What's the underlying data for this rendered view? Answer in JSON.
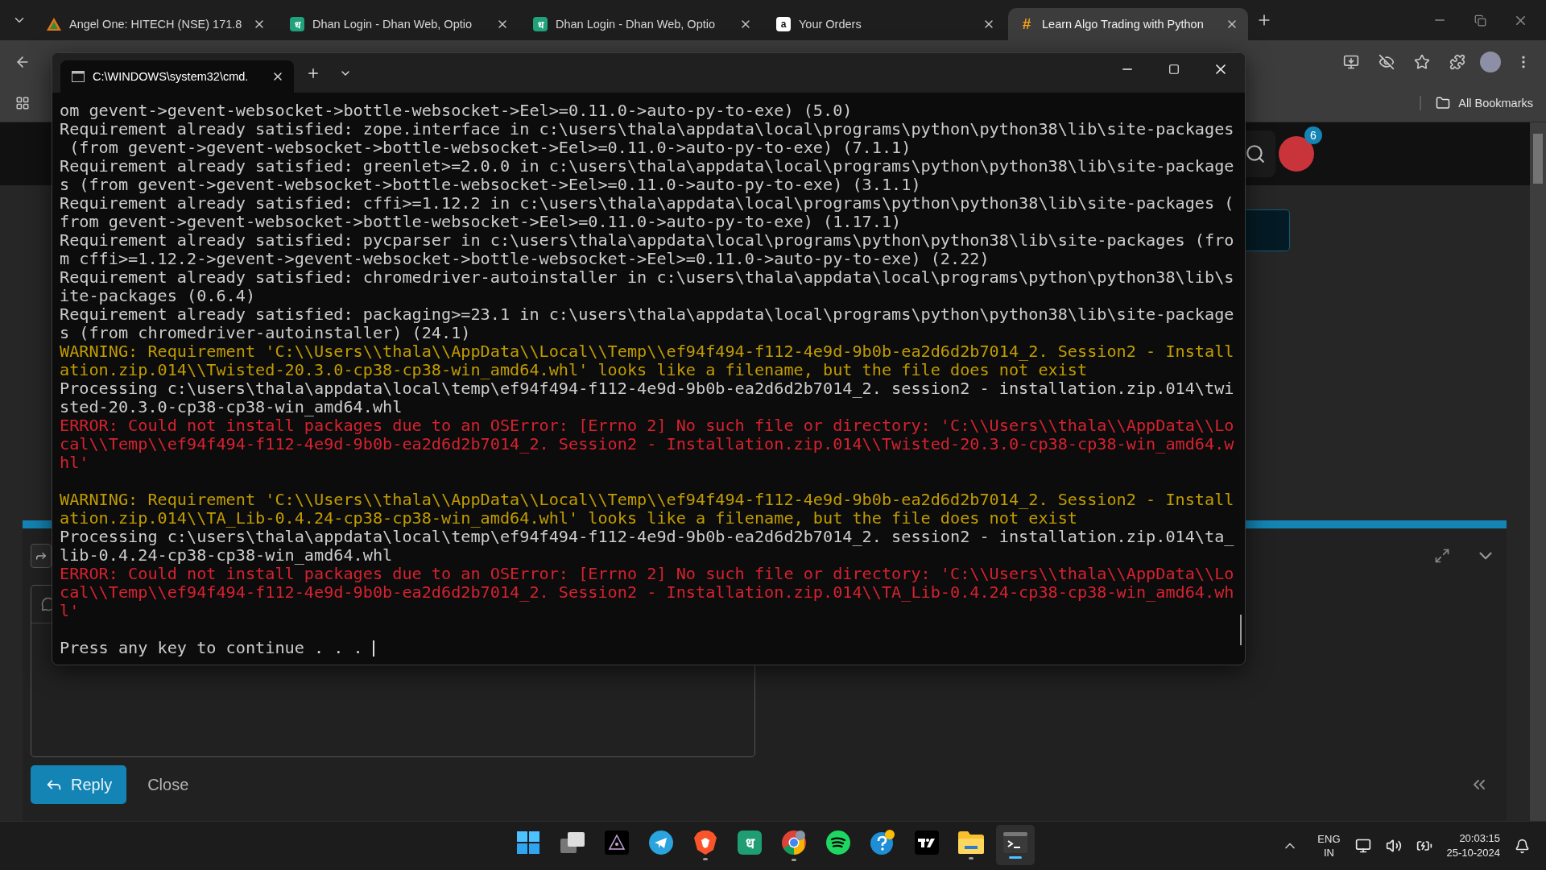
{
  "browser": {
    "tabs": [
      {
        "title": "Angel One: HITECH (NSE) 171.8",
        "kind": "triangle",
        "selected": false
      },
      {
        "title": "Dhan Login - Dhan Web, Optio",
        "kind": "tile",
        "favicon_text": "ध",
        "selected": false
      },
      {
        "title": "Dhan Login - Dhan Web, Optio",
        "kind": "tile",
        "favicon_text": "ध",
        "selected": false
      },
      {
        "title": "Your Orders",
        "kind": "white-tile",
        "favicon_text": "a",
        "selected": false
      },
      {
        "title": "Learn Algo Trading with Python",
        "kind": "plain",
        "favicon_text": "#",
        "selected": true
      }
    ],
    "bookmarks": {
      "label": "All Bookmarks"
    }
  },
  "page": {
    "notification_count": "6",
    "reply_button": "Reply",
    "close_link": "Close"
  },
  "terminal": {
    "title": "C:\\WINDOWS\\system32\\cmd.",
    "lines": [
      {
        "kind": "info",
        "text": "om gevent->gevent-websocket->bottle-websocket->Eel>=0.11.0->auto-py-to-exe) (5.0)"
      },
      {
        "kind": "info",
        "text": "Requirement already satisfied: zope.interface in c:\\users\\thala\\appdata\\local\\programs\\python\\python38\\lib\\site-packages"
      },
      {
        "kind": "info",
        "text": " (from gevent->gevent-websocket->bottle-websocket->Eel>=0.11.0->auto-py-to-exe) (7.1.1)"
      },
      {
        "kind": "info",
        "text": "Requirement already satisfied: greenlet>=2.0.0 in c:\\users\\thala\\appdata\\local\\programs\\python\\python38\\lib\\site-package"
      },
      {
        "kind": "info",
        "text": "s (from gevent->gevent-websocket->bottle-websocket->Eel>=0.11.0->auto-py-to-exe) (3.1.1)"
      },
      {
        "kind": "info",
        "text": "Requirement already satisfied: cffi>=1.12.2 in c:\\users\\thala\\appdata\\local\\programs\\python\\python38\\lib\\site-packages ("
      },
      {
        "kind": "info",
        "text": "from gevent->gevent-websocket->bottle-websocket->Eel>=0.11.0->auto-py-to-exe) (1.17.1)"
      },
      {
        "kind": "info",
        "text": "Requirement already satisfied: pycparser in c:\\users\\thala\\appdata\\local\\programs\\python\\python38\\lib\\site-packages (fro"
      },
      {
        "kind": "info",
        "text": "m cffi>=1.12.2->gevent->gevent-websocket->bottle-websocket->Eel>=0.11.0->auto-py-to-exe) (2.22)"
      },
      {
        "kind": "info",
        "text": "Requirement already satisfied: chromedriver-autoinstaller in c:\\users\\thala\\appdata\\local\\programs\\python\\python38\\lib\\s"
      },
      {
        "kind": "info",
        "text": "ite-packages (0.6.4)"
      },
      {
        "kind": "info",
        "text": "Requirement already satisfied: packaging>=23.1 in c:\\users\\thala\\appdata\\local\\programs\\python\\python38\\lib\\site-package"
      },
      {
        "kind": "info",
        "text": "s (from chromedriver-autoinstaller) (24.1)"
      },
      {
        "kind": "warning",
        "text": "WARNING: Requirement 'C:\\\\Users\\\\thala\\\\AppData\\\\Local\\\\Temp\\\\ef94f494-f112-4e9d-9b0b-ea2d6d2b7014_2. Session2 - Install"
      },
      {
        "kind": "warning",
        "text": "ation.zip.014\\\\Twisted-20.3.0-cp38-cp38-win_amd64.whl' looks like a filename, but the file does not exist"
      },
      {
        "kind": "info",
        "text": "Processing c:\\users\\thala\\appdata\\local\\temp\\ef94f494-f112-4e9d-9b0b-ea2d6d2b7014_2. session2 - installation.zip.014\\twi"
      },
      {
        "kind": "info",
        "text": "sted-20.3.0-cp38-cp38-win_amd64.whl"
      },
      {
        "kind": "error",
        "text": "ERROR: Could not install packages due to an OSError: [Errno 2] No such file or directory: 'C:\\\\Users\\\\thala\\\\AppData\\\\Lo"
      },
      {
        "kind": "error",
        "text": "cal\\\\Temp\\\\ef94f494-f112-4e9d-9b0b-ea2d6d2b7014_2. Session2 - Installation.zip.014\\\\Twisted-20.3.0-cp38-cp38-win_amd64.w"
      },
      {
        "kind": "error",
        "text": "hl'"
      },
      {
        "kind": "blank"
      },
      {
        "kind": "warning",
        "text": "WARNING: Requirement 'C:\\\\Users\\\\thala\\\\AppData\\\\Local\\\\Temp\\\\ef94f494-f112-4e9d-9b0b-ea2d6d2b7014_2. Session2 - Install"
      },
      {
        "kind": "warning",
        "text": "ation.zip.014\\\\TA_Lib-0.4.24-cp38-cp38-win_amd64.whl' looks like a filename, but the file does not exist"
      },
      {
        "kind": "info",
        "text": "Processing c:\\users\\thala\\appdata\\local\\temp\\ef94f494-f112-4e9d-9b0b-ea2d6d2b7014_2. session2 - installation.zip.014\\ta_"
      },
      {
        "kind": "info",
        "text": "lib-0.4.24-cp38-cp38-win_amd64.whl"
      },
      {
        "kind": "error",
        "text": "ERROR: Could not install packages due to an OSError: [Errno 2] No such file or directory: 'C:\\\\Users\\\\thala\\\\AppData\\\\Lo"
      },
      {
        "kind": "error",
        "text": "cal\\\\Temp\\\\ef94f494-f112-4e9d-9b0b-ea2d6d2b7014_2. Session2 - Installation.zip.014\\\\TA_Lib-0.4.24-cp38-cp38-win_amd64.wh"
      },
      {
        "kind": "error",
        "text": "l'"
      },
      {
        "kind": "blank"
      },
      {
        "kind": "prompt",
        "text": "Press any key to continue . . . "
      }
    ]
  },
  "taskbar": {
    "apps": [
      {
        "kind": "start",
        "open": false,
        "selected": false
      },
      {
        "kind": "taskview",
        "open": false,
        "selected": false
      },
      {
        "kind": "pyramid",
        "open": false,
        "selected": false
      },
      {
        "kind": "telegram",
        "open": false,
        "selected": false
      },
      {
        "kind": "brave",
        "open": true,
        "selected": false
      },
      {
        "kind": "tile",
        "icon_text": "ध",
        "open": false,
        "selected": false
      },
      {
        "kind": "chrome",
        "open": true,
        "selected": false
      },
      {
        "kind": "spotify",
        "open": false,
        "selected": false
      },
      {
        "kind": "help",
        "open": false,
        "selected": false
      },
      {
        "kind": "tradingview",
        "open": false,
        "selected": false
      },
      {
        "kind": "folder",
        "open": true,
        "selected": false
      },
      {
        "kind": "terminal",
        "open": true,
        "selected": true
      }
    ],
    "language": "ENG",
    "region": "IN",
    "time": "20:03:15",
    "date": "25-10-2024"
  }
}
